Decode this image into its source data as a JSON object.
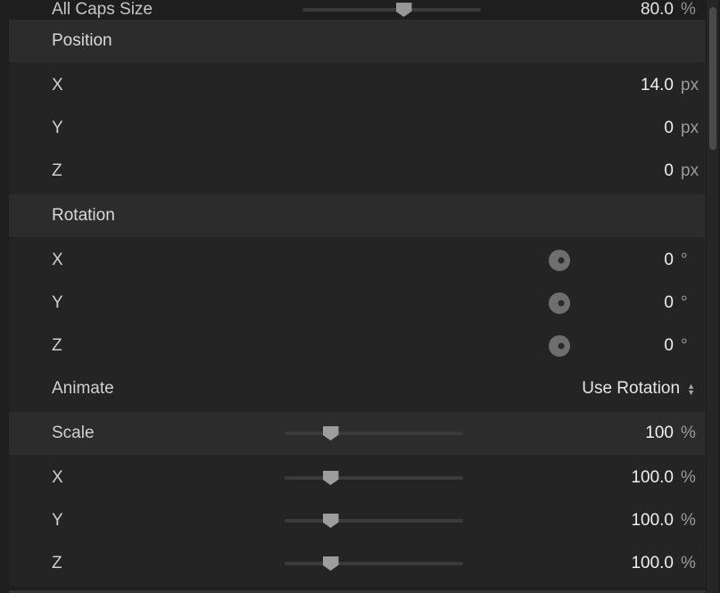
{
  "allCapsSize": {
    "label": "All Caps Size",
    "value": "80.0",
    "unit": "%"
  },
  "position": {
    "header": "Position",
    "x": {
      "label": "X",
      "value": "14.0",
      "unit": "px"
    },
    "y": {
      "label": "Y",
      "value": "0",
      "unit": "px"
    },
    "z": {
      "label": "Z",
      "value": "0",
      "unit": "px"
    }
  },
  "rotation": {
    "header": "Rotation",
    "x": {
      "label": "X",
      "value": "0",
      "unit": "°"
    },
    "y": {
      "label": "Y",
      "value": "0",
      "unit": "°"
    },
    "z": {
      "label": "Z",
      "value": "0",
      "unit": "°"
    },
    "animate": {
      "label": "Animate",
      "value": "Use Rotation"
    }
  },
  "scale": {
    "header": "Scale",
    "overall": {
      "value": "100",
      "unit": "%"
    },
    "x": {
      "label": "X",
      "value": "100.0",
      "unit": "%"
    },
    "y": {
      "label": "Y",
      "value": "100.0",
      "unit": "%"
    },
    "z": {
      "label": "Z",
      "value": "100.0",
      "unit": "%"
    }
  },
  "sliderPositions": {
    "allCapsSize": 57,
    "scaleOverall": 26,
    "scaleX": 26,
    "scaleY": 26,
    "scaleZ": 26
  }
}
